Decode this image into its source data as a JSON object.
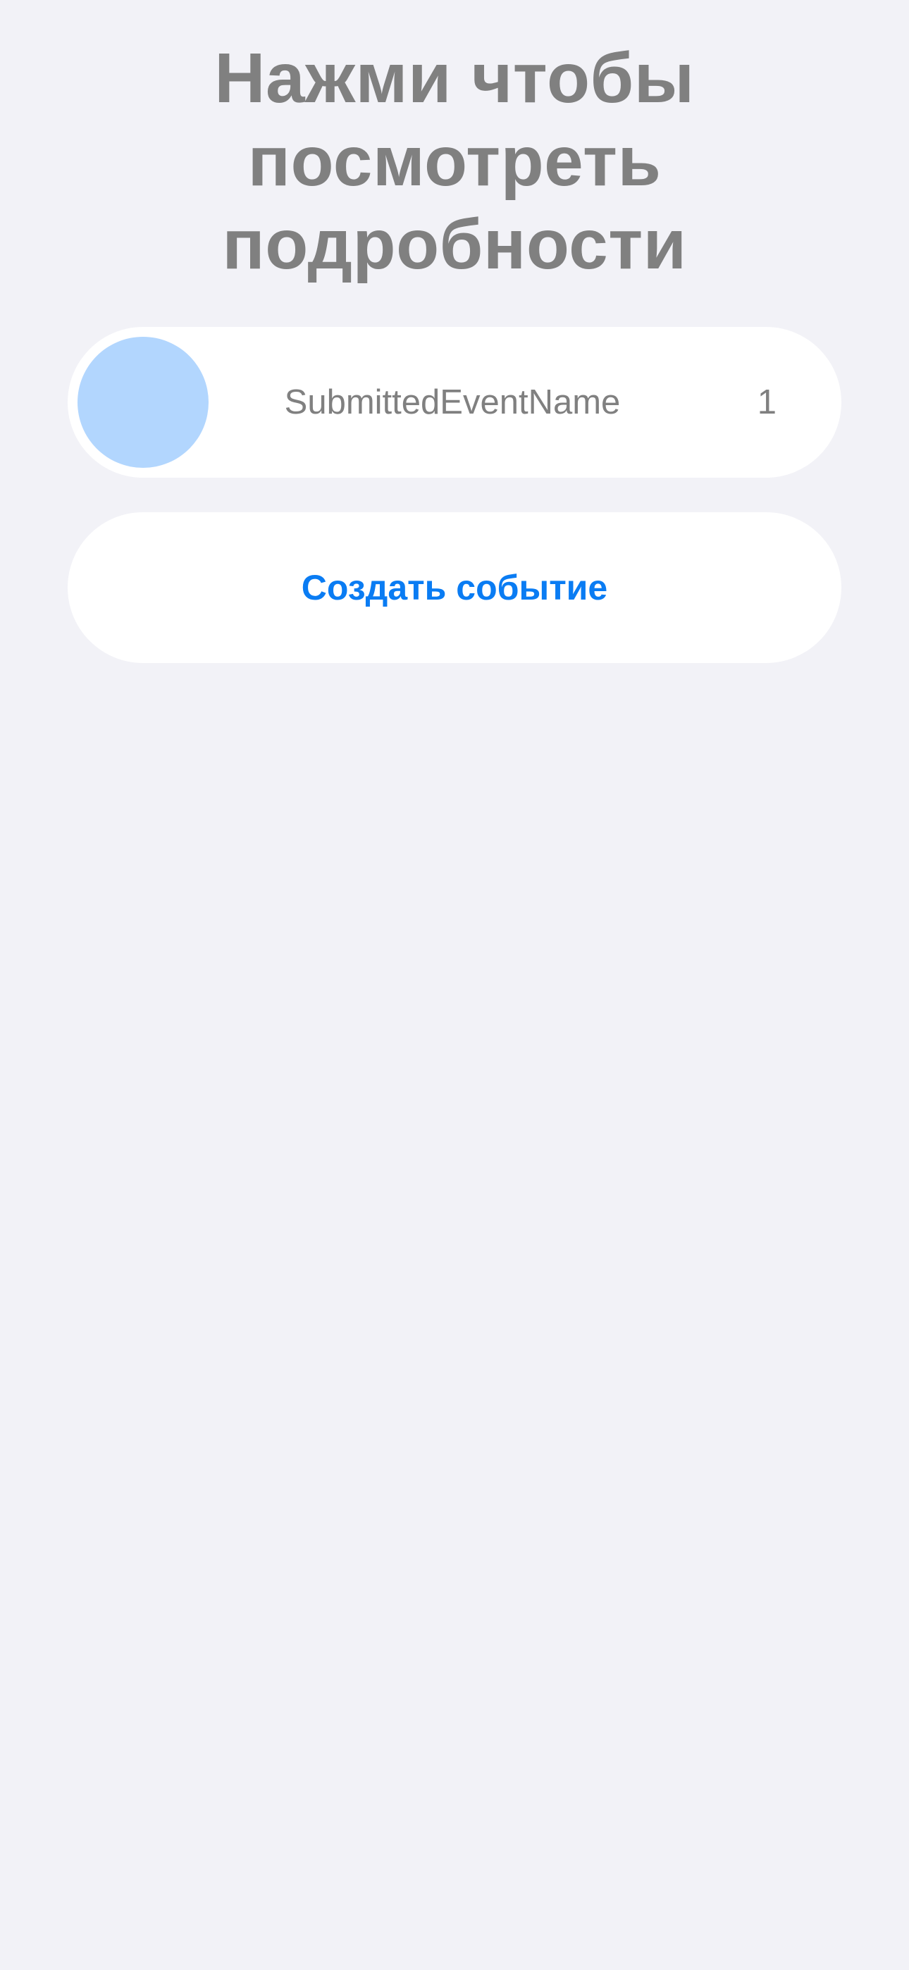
{
  "header": {
    "title_lines": [
      "Нажми чтобы",
      "посмотреть",
      "подробности"
    ]
  },
  "events": [
    {
      "name": "SubmittedEventName",
      "count": "1",
      "avatar_color": "#b2d6fe"
    }
  ],
  "actions": {
    "create_event_label": "Создать событие"
  },
  "colors": {
    "background": "#f2f2f7",
    "card": "#ffffff",
    "text_secondary": "#808080",
    "accent": "#0a7cf3"
  }
}
